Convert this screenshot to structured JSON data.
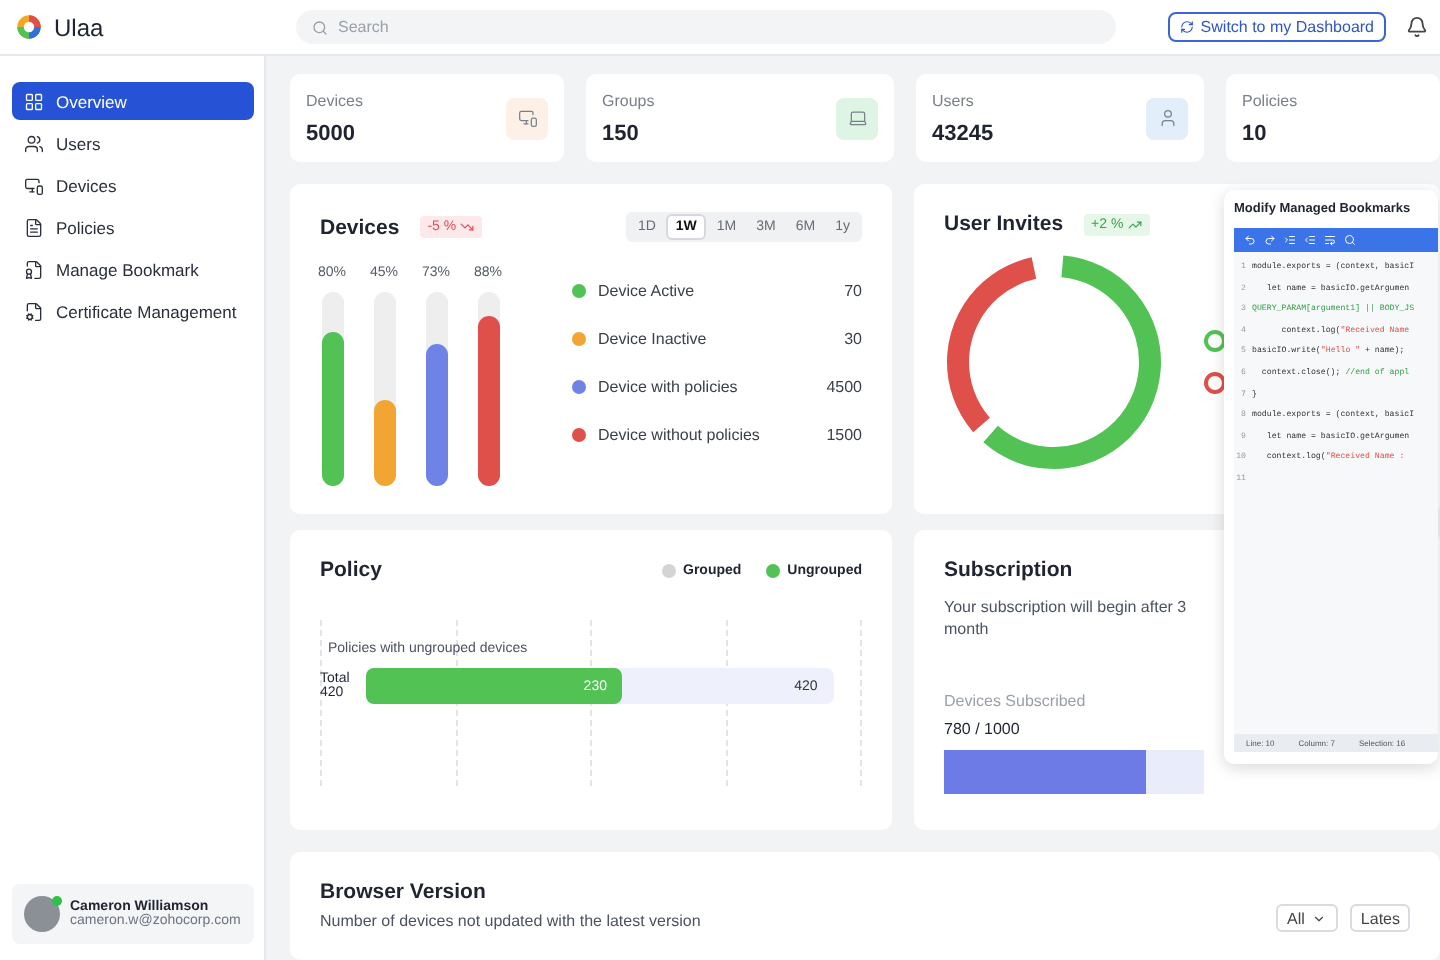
{
  "app": {
    "name": "Ulaa"
  },
  "search": {
    "placeholder": "Search"
  },
  "header_button": "Switch to my Dashboard",
  "sidebar": {
    "items": [
      {
        "label": "Overview",
        "selected": true
      },
      {
        "label": "Users",
        "selected": false
      },
      {
        "label": "Devices",
        "selected": false
      },
      {
        "label": "Policies",
        "selected": false
      },
      {
        "label": "Manage Bookmark",
        "selected": false
      },
      {
        "label": "Certificate Management",
        "selected": false
      }
    ],
    "user": {
      "name": "Cameron Williamson",
      "email": "cameron.w@zohocorp.com",
      "online": true
    }
  },
  "stats": [
    {
      "label": "Devices",
      "value": "5000",
      "color": "#fdf0e6"
    },
    {
      "label": "Groups",
      "value": "150",
      "color": "#def5e6"
    },
    {
      "label": "Users",
      "value": "43245",
      "color": "#e3eefb"
    },
    {
      "label": "Policies",
      "value": "10"
    }
  ],
  "devices_card": {
    "title": "Devices",
    "badge": "-5 %",
    "kind": "down",
    "ranges": [
      {
        "label": "1D",
        "selected": false
      },
      {
        "label": "1W",
        "selected": true
      },
      {
        "label": "1M",
        "selected": false
      },
      {
        "label": "3M",
        "selected": false
      },
      {
        "label": "6M",
        "selected": false
      },
      {
        "label": "1y",
        "selected": false
      }
    ],
    "bars": [
      {
        "label": "80%",
        "level": 0.8
      },
      {
        "label": "45%",
        "level": 0.45
      },
      {
        "label": "73%",
        "level": 0.73
      },
      {
        "label": "88%",
        "level": 0.88
      }
    ],
    "legend": [
      {
        "label": "Device Active",
        "value": "70",
        "color": "#52c255"
      },
      {
        "label": "Device Inactive",
        "value": "30",
        "color": "#f2a533"
      },
      {
        "label": "Device with policies",
        "value": "4500",
        "color": "#6f83e6"
      },
      {
        "label": "Device without policies",
        "value": "1500",
        "color": "#e0504a"
      }
    ]
  },
  "invites_card": {
    "title": "User Invites",
    "badge": "+2 %",
    "kind": "up",
    "legend": [
      {
        "color": "#52c255"
      },
      {
        "color": "#e0504a"
      }
    ]
  },
  "editor": {
    "title": "Modify Managed Bookmarks",
    "lines": [
      {
        "number": "1",
        "segments": [
          {
            "text": "module.exports = (context, basicI",
            "kind": "plain"
          }
        ]
      },
      {
        "number": "2",
        "segments": [
          {
            "text": "   let name = basicIO.getArgumen",
            "kind": "plain"
          }
        ]
      },
      {
        "number": "3",
        "segments": [
          {
            "text": "QUERY_PARAM[argument1] || BODY_JS",
            "kind": "green"
          }
        ]
      },
      {
        "number": "4",
        "segments": [
          {
            "text": "      context.log(",
            "kind": "plain"
          },
          {
            "text": "\"Received Name",
            "kind": "string"
          }
        ]
      },
      {
        "number": "5",
        "segments": [
          {
            "text": "basicIO.write(",
            "kind": "plain"
          },
          {
            "text": "\"Hello \"",
            "kind": "string"
          },
          {
            "text": " + name);",
            "kind": "plain"
          }
        ]
      },
      {
        "number": "6",
        "segments": [
          {
            "text": "  context.close(); ",
            "kind": "plain"
          },
          {
            "text": "//end of appl",
            "kind": "green"
          }
        ]
      },
      {
        "number": "7",
        "segments": [
          {
            "text": "}",
            "kind": "plain"
          }
        ]
      },
      {
        "number": "8",
        "segments": [
          {
            "text": "module.exports = (context, basicI",
            "kind": "plain"
          }
        ]
      },
      {
        "number": "9",
        "segments": [
          {
            "text": "   let name = basicIO.getArgumen",
            "kind": "plain"
          }
        ]
      },
      {
        "number": "10",
        "segments": [
          {
            "text": "   context.log(",
            "kind": "plain"
          },
          {
            "text": "\"Received Name :",
            "kind": "string"
          }
        ]
      },
      {
        "number": "11"
      }
    ],
    "status": [
      "Line: 10",
      "Column: 7",
      "Selection: 16"
    ]
  },
  "policy_card": {
    "title": "Policy",
    "legend": [
      {
        "label": "Grouped",
        "color": "#d4d4d4"
      },
      {
        "label": "Ungrouped",
        "color": "#52c255"
      }
    ],
    "bar_title": "Policies with ungrouped devices",
    "bar_label": "Total\n420",
    "bar": {
      "value": "230",
      "total": "420",
      "level": 0.55
    }
  },
  "subscription_card": {
    "title": "Subscription",
    "text": "Your subscription will begin after 3 month",
    "label": "Devices Subscribed",
    "value": "780 / 1000",
    "level": 0.78
  },
  "browser_card": {
    "title": "Browser Version",
    "subtitle": "Number of devices not updated with the latest version",
    "filter": "All",
    "button": "Lates"
  }
}
